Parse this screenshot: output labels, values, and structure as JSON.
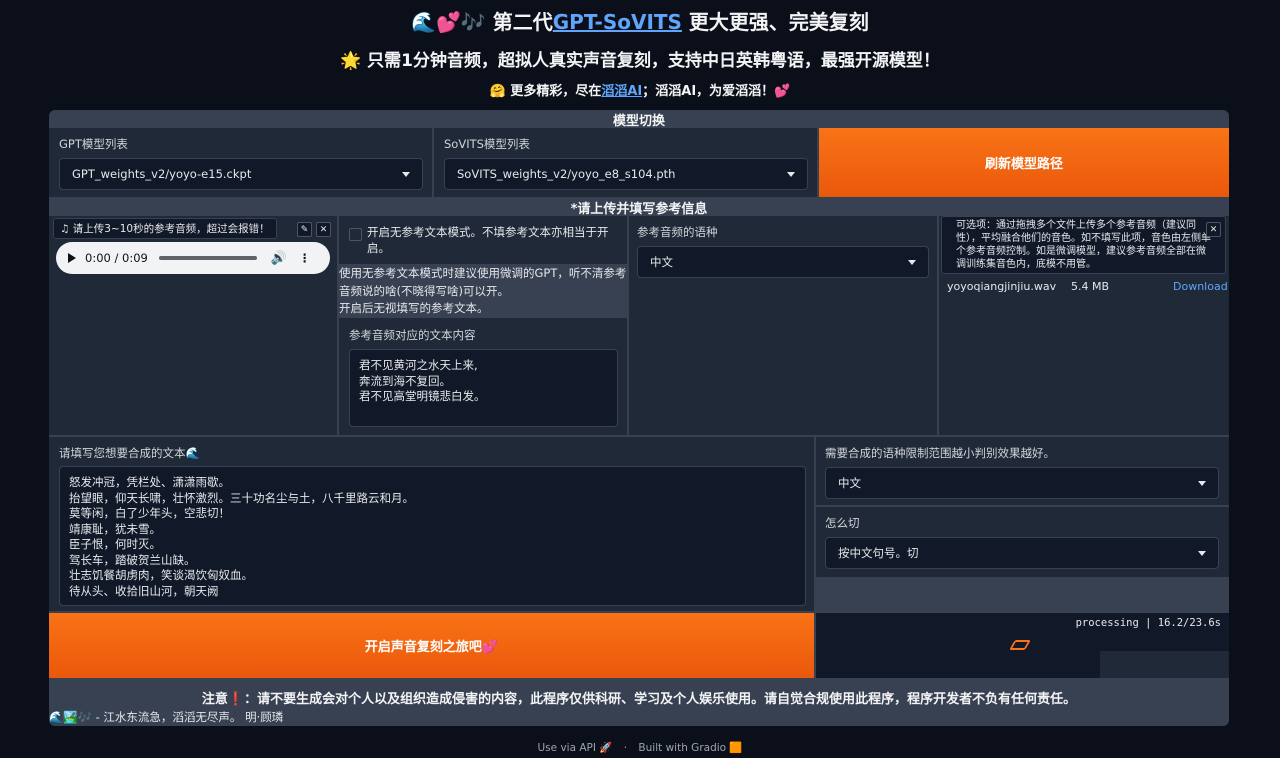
{
  "header": {
    "title_prefix": "🌊💕🎶 第二代",
    "title_link": "GPT-SoVITS",
    "title_suffix": " 更大更强、完美复刻",
    "subtitle": "🌟 只需1分钟音频，超拟人真实声音复刻，支持中日英韩粤语，最强开源模型！",
    "tagline_prefix": "🤗 更多精彩，尽在",
    "tagline_link": "滔滔AI",
    "tagline_suffix": "；滔滔AI，为爱滔滔！💕"
  },
  "model_switch": {
    "title": "模型切换",
    "gpt_label": "GPT模型列表",
    "gpt_value": "GPT_weights_v2/yoyo-e15.ckpt",
    "sovits_label": "SoVITS模型列表",
    "sovits_value": "SoVITS_weights_v2/yoyo_e8_s104.pth",
    "refresh_button": "刷新模型路径"
  },
  "reference": {
    "title": "*请上传并填写参考信息",
    "audio_label": "♫ 请上传3~10秒的参考音频，超过会报错！",
    "audio_time": "0:00 / 0:09",
    "audio_progress": 0,
    "no_ref_checkbox_label": "开启无参考文本模式。不填参考文本亦相当于开启。",
    "no_ref_checked": false,
    "no_ref_info": "使用无参考文本模式时建议使用微调的GPT，听不清参考音频说的啥(不晓得写啥)可以开。\n开启后无视填写的参考文本。",
    "ref_text_label": "参考音频对应的文本内容",
    "ref_text": "君不见黄河之水天上来,\n奔流到海不复回。\n君不见高堂明镜悲白发。",
    "ref_lang_label": "参考音频的语种",
    "ref_lang_value": "中文",
    "multi_ref_hint": "可选项：通过拖拽多个文件上传多个参考音频（建议同性），平均融合他们的音色。如不填写此项，音色由左侧单个参考音频控制。如是微调模型，建议参考音频全部在微调训练集音色内，底模不用管。",
    "file_name": "yoyoqiangjinjiu.wav",
    "file_size": "5.4 MB",
    "file_download": "Download"
  },
  "synthesis": {
    "text_label": "请填写您想要合成的文本🌊",
    "text_value": "怒发冲冠，凭栏处、潇潇雨歇。\n抬望眼，仰天长啸，壮怀激烈。三十功名尘与土，八千里路云和月。\n莫等闲，白了少年头，空悲切！\n靖康耻，犹未雪。\n臣子恨，何时灭。\n驾长车，踏破贺兰山缺。\n壮志饥餐胡虏肉，笑谈渴饮匈奴血。\n待从头、收拾旧山河，朝天阙",
    "lang_label": "需要合成的语种限制范围越小判别效果越好。",
    "lang_value": "中文",
    "cut_label": "怎么切",
    "cut_value": "按中文句号。切",
    "start_button": "开启声音复刻之旅吧💕",
    "status": "processing | 16.2/23.6s"
  },
  "notice": {
    "text": "注意❗：请不要生成会对个人以及组织造成侵害的内容，此程序仅供科研、学习及个人娱乐使用。请自觉合规使用此程序，程序开发者不负有任何责任。",
    "poem": "🌊🏞️🎶 - 江水东流急，滔滔无尽声。 明·顾璘"
  },
  "footer": {
    "api": "Use via API 🚀",
    "sep": "·",
    "built": "Built with Gradio 🟧"
  },
  "colors": {
    "accent": "#ea580c",
    "background": "#0b0f19",
    "panel": "#1f2937",
    "link": "#60a5fa"
  }
}
